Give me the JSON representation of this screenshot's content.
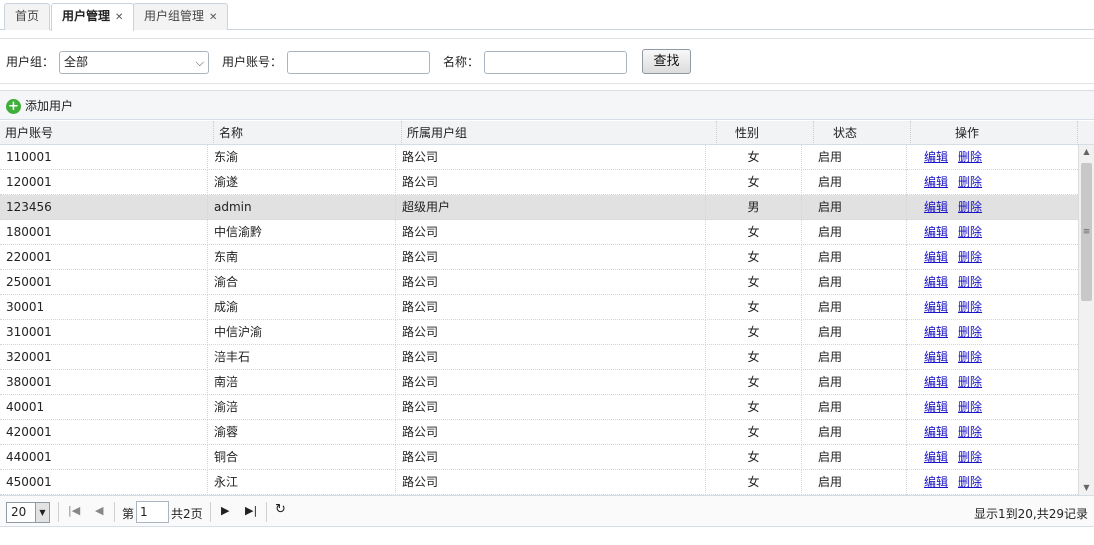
{
  "tabs": [
    {
      "label": "首页",
      "closable": false,
      "active": false
    },
    {
      "label": "用户管理",
      "closable": true,
      "active": true
    },
    {
      "label": "用户组管理",
      "closable": true,
      "active": false
    }
  ],
  "search": {
    "group_label": "用户组：",
    "group_value": "全部",
    "account_label": "用户账号：",
    "account_value": "",
    "name_label": "名称：",
    "name_value": "",
    "find_button": "查找"
  },
  "toolbar": {
    "add_user": "添加用户"
  },
  "grid": {
    "columns": [
      "用户账号",
      "名称",
      "所属用户组",
      "性别",
      "状态",
      "操作"
    ],
    "rows": [
      {
        "account": "110001",
        "name": "东渝",
        "group": "路公司",
        "gender": "女",
        "status": "启用",
        "selected": false
      },
      {
        "account": "120001",
        "name": "渝遂",
        "group": "路公司",
        "gender": "女",
        "status": "启用",
        "selected": false
      },
      {
        "account": "123456",
        "name": "admin",
        "group": "超级用户",
        "gender": "男",
        "status": "启用",
        "selected": true
      },
      {
        "account": "180001",
        "name": "中信渝黔",
        "group": "路公司",
        "gender": "女",
        "status": "启用",
        "selected": false
      },
      {
        "account": "220001",
        "name": "东南",
        "group": "路公司",
        "gender": "女",
        "status": "启用",
        "selected": false
      },
      {
        "account": "250001",
        "name": "渝合",
        "group": "路公司",
        "gender": "女",
        "status": "启用",
        "selected": false
      },
      {
        "account": "30001",
        "name": "成渝",
        "group": "路公司",
        "gender": "女",
        "status": "启用",
        "selected": false
      },
      {
        "account": "310001",
        "name": "中信沪渝",
        "group": "路公司",
        "gender": "女",
        "status": "启用",
        "selected": false
      },
      {
        "account": "320001",
        "name": "涪丰石",
        "group": "路公司",
        "gender": "女",
        "status": "启用",
        "selected": false
      },
      {
        "account": "380001",
        "name": "南涪",
        "group": "路公司",
        "gender": "女",
        "status": "启用",
        "selected": false
      },
      {
        "account": "40001",
        "name": "渝涪",
        "group": "路公司",
        "gender": "女",
        "status": "启用",
        "selected": false
      },
      {
        "account": "420001",
        "name": "渝蓉",
        "group": "路公司",
        "gender": "女",
        "status": "启用",
        "selected": false
      },
      {
        "account": "440001",
        "name": "铜合",
        "group": "路公司",
        "gender": "女",
        "status": "启用",
        "selected": false
      },
      {
        "account": "450001",
        "name": "永江",
        "group": "路公司",
        "gender": "女",
        "status": "启用",
        "selected": false
      }
    ],
    "edit_label": "编辑",
    "delete_label": "删除"
  },
  "pager": {
    "page_size": "20",
    "page_prefix": "第",
    "current_page": "1",
    "total_pages_text": "共2页",
    "info": "显示1到20,共29记录"
  },
  "icons": {
    "add": "plus-circle-icon",
    "first": "first-page-icon",
    "prev": "prev-page-icon",
    "next": "next-page-icon",
    "last": "last-page-icon",
    "refresh": "refresh-icon"
  },
  "colors": {
    "link": "#1a12c6",
    "add_icon": "#3fae3a",
    "selected_row": "#e1e1e1"
  }
}
